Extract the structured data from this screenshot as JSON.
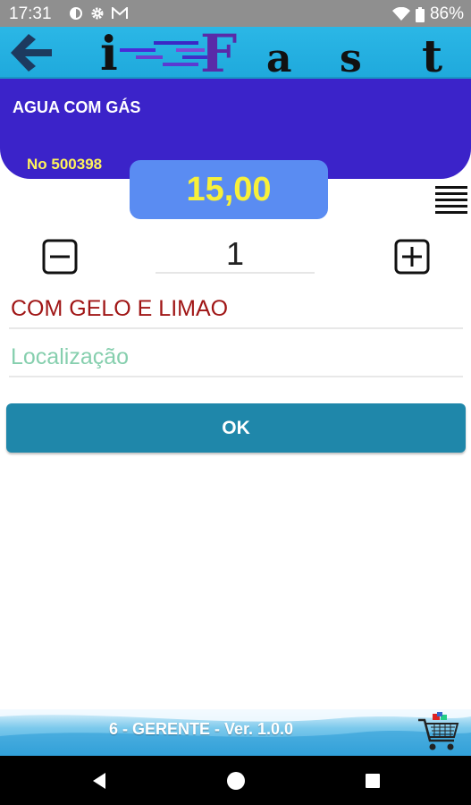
{
  "status_bar": {
    "time": "17:31",
    "battery": "86%",
    "icons": [
      "circle-status-icon",
      "gear-icon",
      "gmail-icon",
      "wifi-icon",
      "battery-icon"
    ]
  },
  "header": {
    "back_icon": "arrow-left-icon",
    "logo_text": "i-Fast",
    "logo_letters": [
      "i",
      "-",
      "F",
      "a",
      "s",
      "t"
    ]
  },
  "product": {
    "name": "AGUA COM GÁS",
    "order_number": "No 500398",
    "price": "15,00"
  },
  "quantity": {
    "value": "1",
    "minus_icon": "minus-square-icon",
    "plus_icon": "plus-square-icon"
  },
  "fields": {
    "observation_value": "COM GELO E LIMAO",
    "location_placeholder": "Localização"
  },
  "actions": {
    "ok_label": "OK",
    "menu_icon": "hamburger-menu-icon"
  },
  "footer": {
    "text": "6 - GERENTE -   Ver. 1.0.0",
    "cart_icon": "shopping-cart-icon"
  },
  "navigation": {
    "back": "back-triangle-icon",
    "home": "home-circle-icon",
    "recent": "recent-square-icon"
  },
  "colors": {
    "header": "#1fa9dc",
    "product_card": "#3b23c9",
    "price_badge": "#5a8cf2",
    "price_text": "#f7f03a",
    "ok_button": "#1f87aa",
    "observation_text": "#a01616",
    "placeholder_text": "#86cfae"
  }
}
